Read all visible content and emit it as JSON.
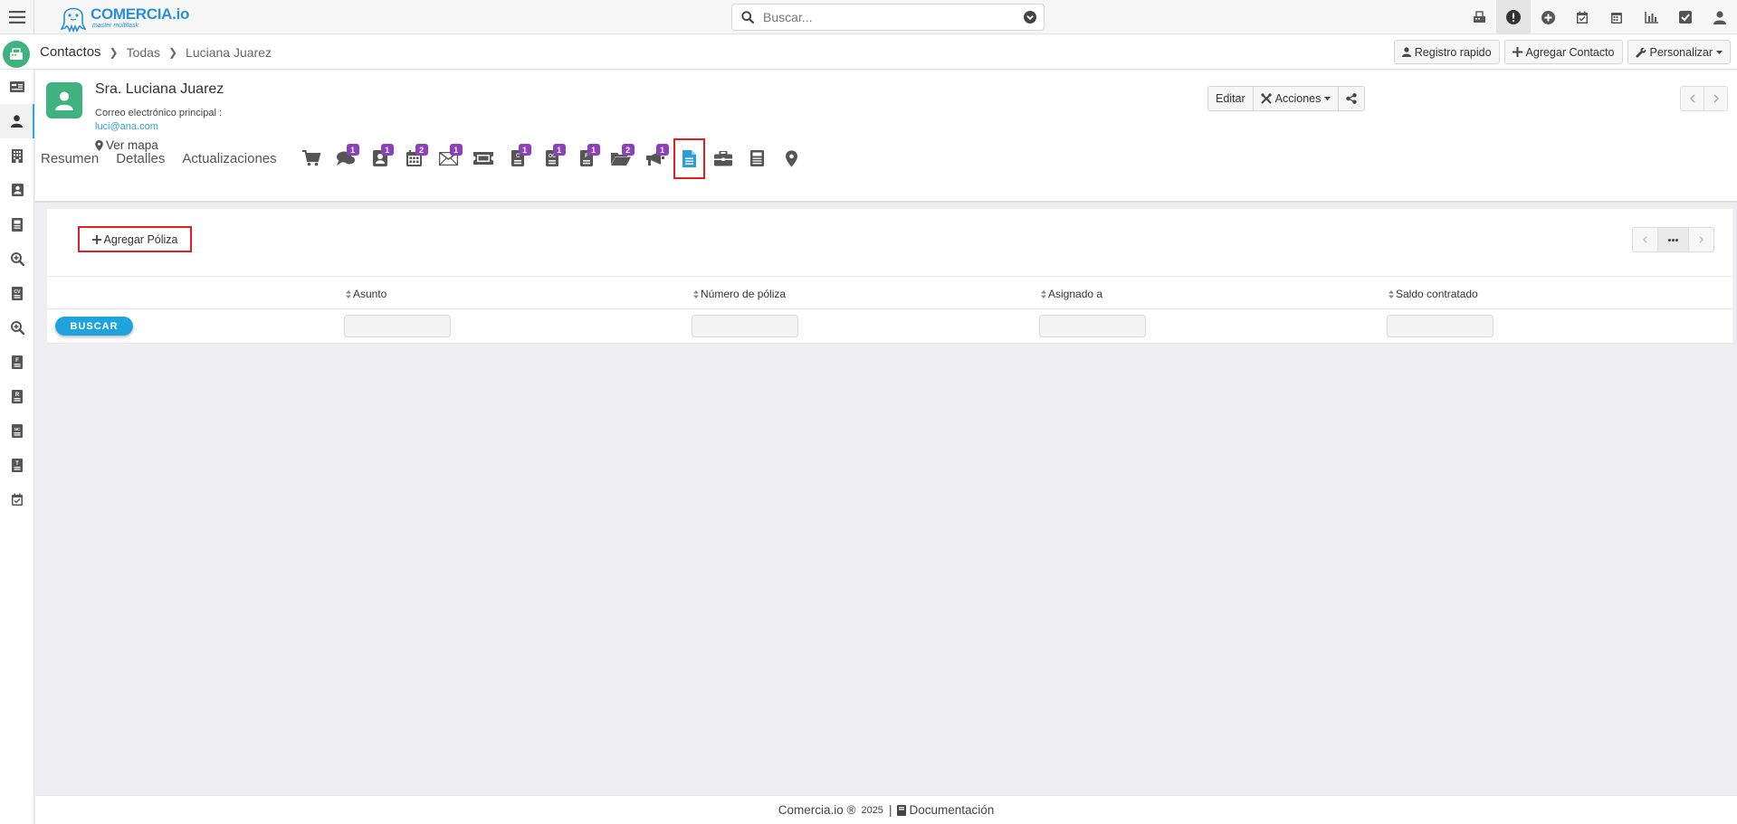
{
  "brand": {
    "name": "COMERCIA.io",
    "tagline": "master multitask"
  },
  "search": {
    "placeholder": "Buscar..."
  },
  "topbar_icons": [
    "fax-icon",
    "alert-icon",
    "plus-circle-icon",
    "calendar-check-icon",
    "calendar-icon",
    "bar-chart-icon",
    "checkbox-icon",
    "user-icon"
  ],
  "breadcrumb": {
    "module": "Contactos",
    "view": "Todas",
    "record": "Luciana Juarez"
  },
  "header_buttons": {
    "quick_register": "Registro rapido",
    "add_contact": "Agregar Contacto",
    "customize": "Personalizar"
  },
  "sidebar_icons": [
    "id-card-icon",
    "contact-icon",
    "building-icon",
    "address-book-icon",
    "document-icon",
    "search-plus-icon",
    "quote-icon",
    "search-plus-icon",
    "invoice-icon",
    "receipt-icon",
    "note-icon",
    "form-icon",
    "calendar-check-icon"
  ],
  "contact": {
    "name": "Sra. Luciana Juarez",
    "email_label": "Correo electrónico principal :",
    "email": "luci@ana.com",
    "map_link": "Ver mapa"
  },
  "record_actions": {
    "edit": "Editar",
    "actions": "Acciones"
  },
  "tabs": {
    "text": [
      "Resumen",
      "Detalles",
      "Actualizaciones"
    ],
    "icons": [
      {
        "icon": "cart-icon",
        "badge": ""
      },
      {
        "icon": "comments-icon",
        "badge": "1"
      },
      {
        "icon": "contact-card-icon",
        "badge": "1"
      },
      {
        "icon": "calendar-icon",
        "badge": "2"
      },
      {
        "icon": "email-icon",
        "badge": "1"
      },
      {
        "icon": "ticket-icon",
        "badge": ""
      },
      {
        "icon": "quote-icon",
        "badge": "1"
      },
      {
        "icon": "order-icon",
        "badge": "1"
      },
      {
        "icon": "invoice-icon",
        "badge": "1"
      },
      {
        "icon": "folder-icon",
        "badge": "2"
      },
      {
        "icon": "megaphone-icon",
        "badge": "1"
      },
      {
        "icon": "policy-document-icon",
        "badge": "",
        "selected": true
      },
      {
        "icon": "briefcase-icon",
        "badge": ""
      },
      {
        "icon": "calculator-icon",
        "badge": ""
      },
      {
        "icon": "map-marker-icon",
        "badge": ""
      }
    ]
  },
  "policies": {
    "add_button": "Agregar Póliza",
    "search_button": "BUSCAR",
    "columns": [
      "Asunto",
      "Número de póliza",
      "Asignado a",
      "Saldo contratado"
    ]
  },
  "footer": {
    "brand": "Comercia.io ®",
    "year": "2025",
    "separator": "|",
    "docs": "Documentación"
  },
  "colors": {
    "accent": "#2a9fd6",
    "green": "#3fb27f",
    "badge": "#8e3fba",
    "highlight": "#e02020"
  }
}
